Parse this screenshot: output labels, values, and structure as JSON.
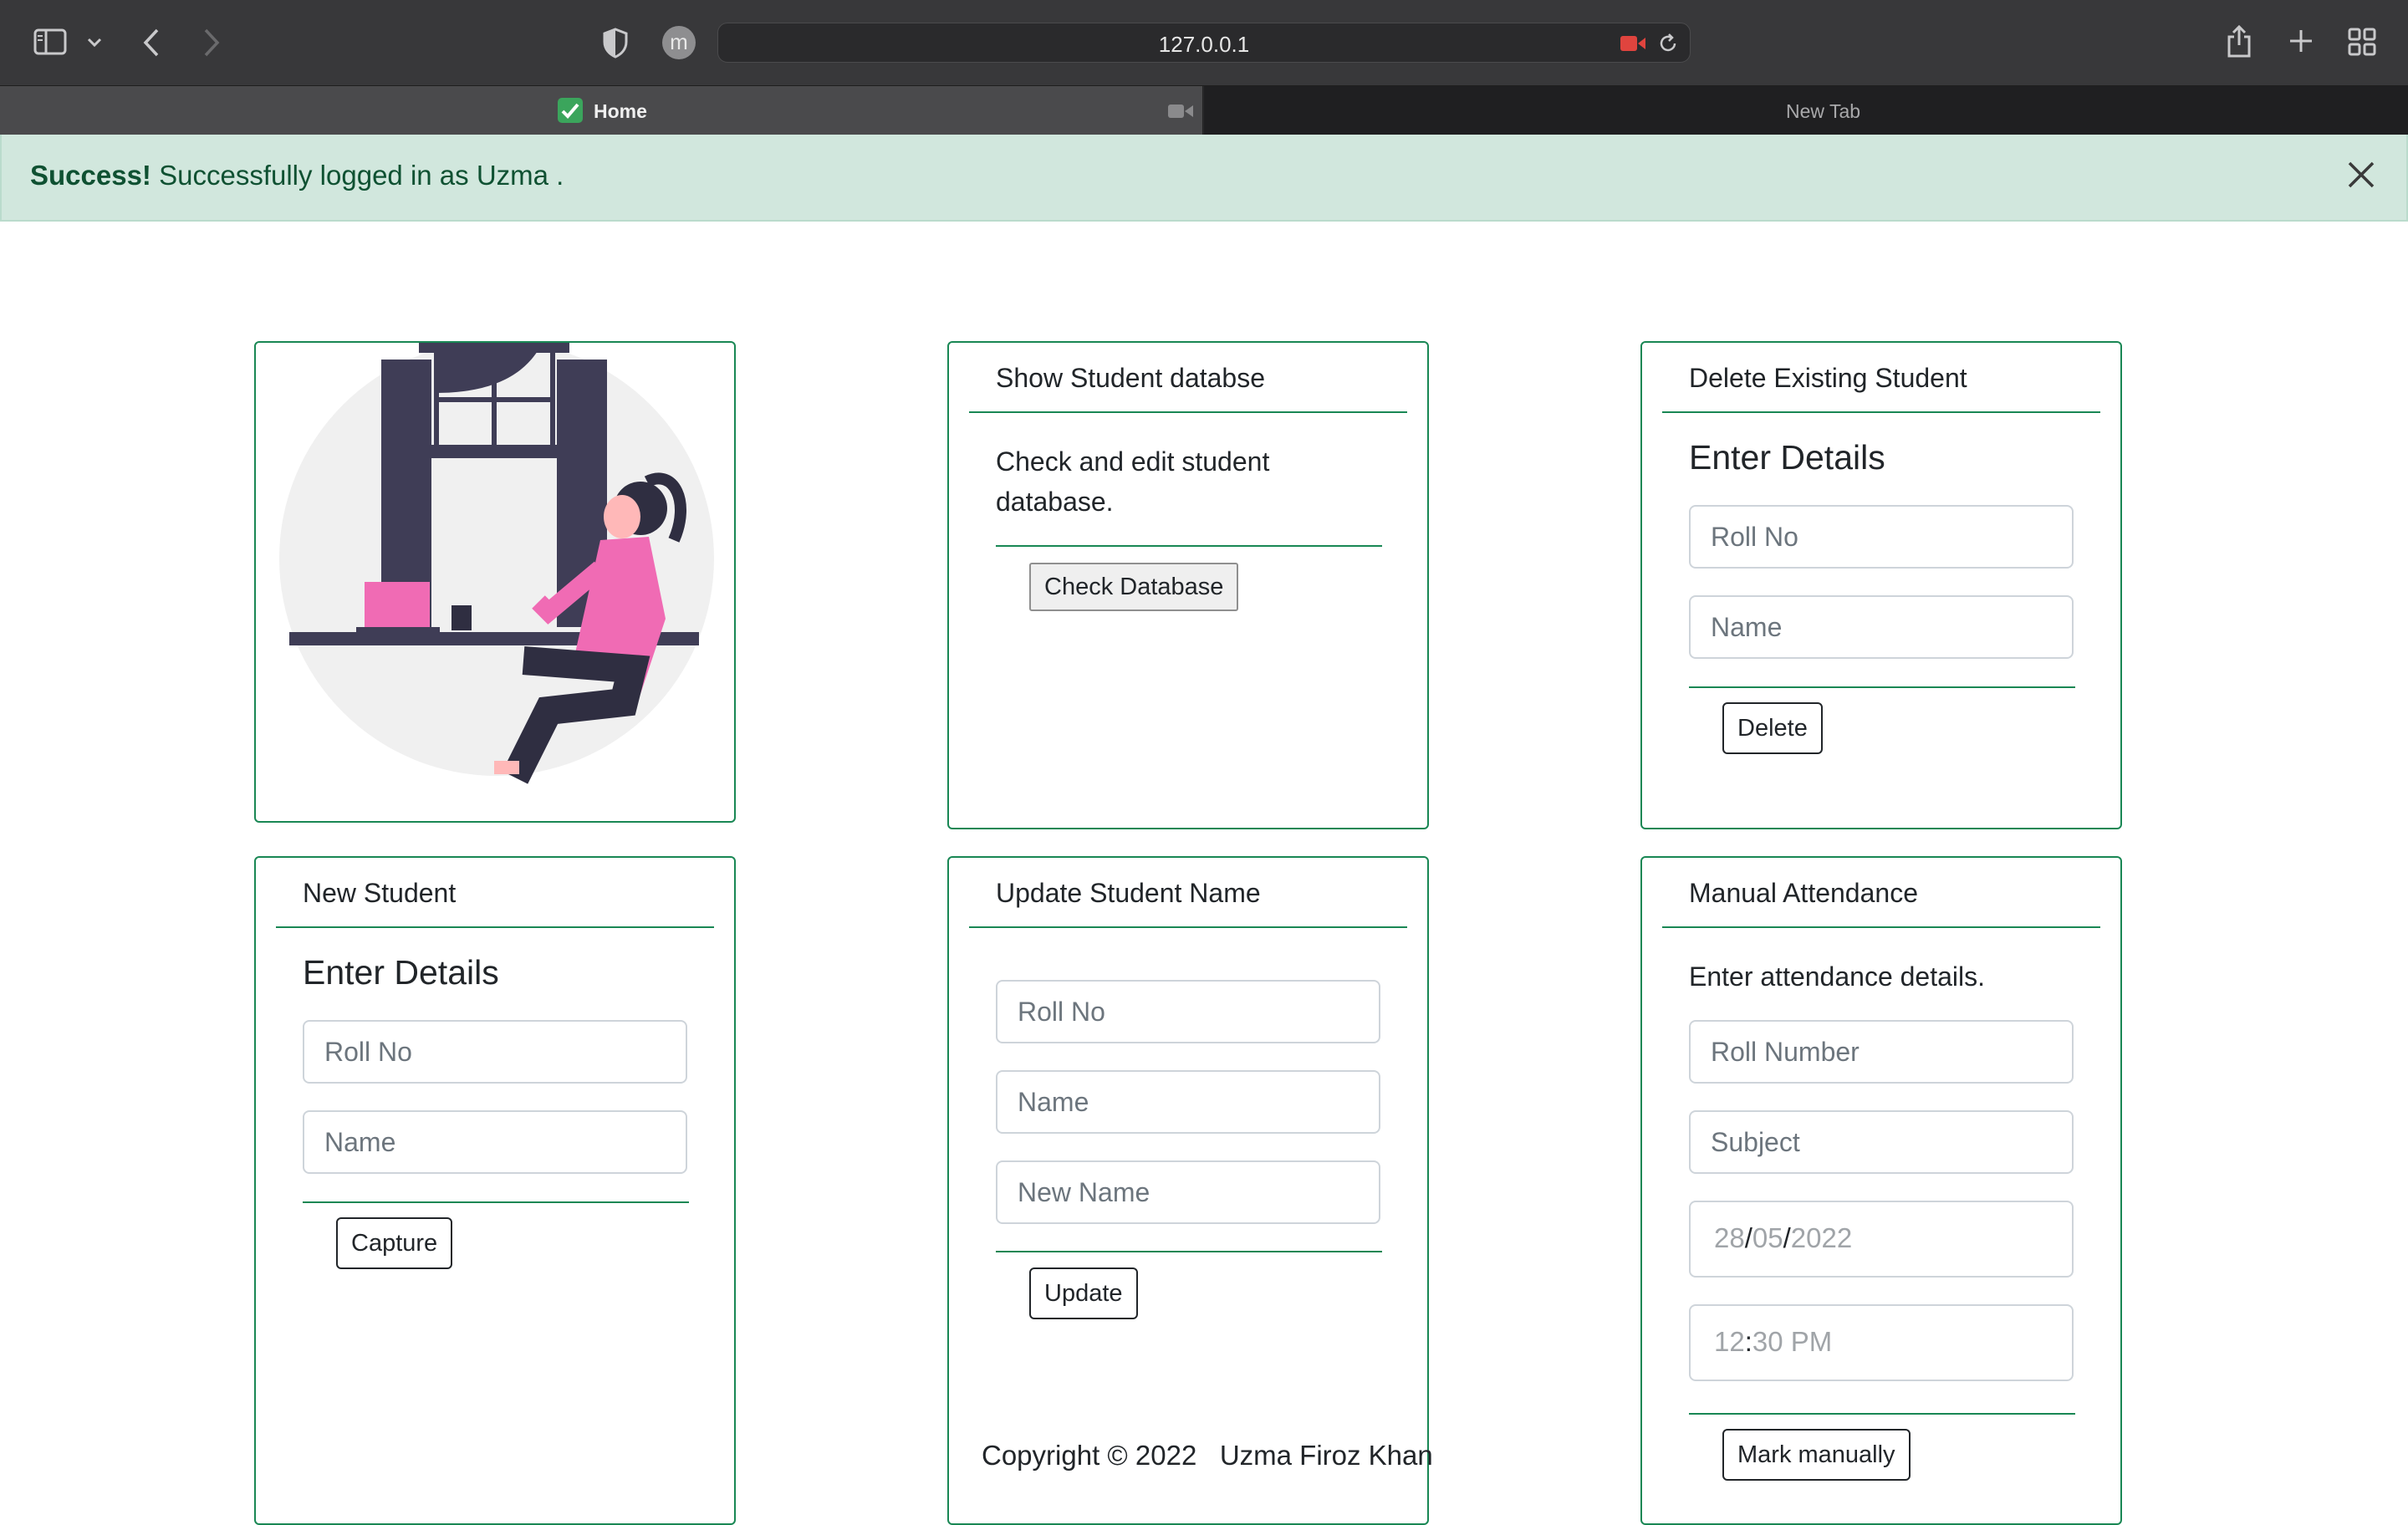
{
  "browser": {
    "url": "127.0.0.1",
    "tabs": [
      {
        "label": "Home",
        "active": true
      },
      {
        "label": "New Tab",
        "active": false
      }
    ],
    "profile_initial": "m"
  },
  "alert": {
    "strong": "Success!",
    "message": "Successfully logged in as Uzma .",
    "color": "#d1e7dd"
  },
  "cards": {
    "show_db": {
      "header": "Show Student databse",
      "text": "Check and edit student database.",
      "button": "Check Database"
    },
    "delete": {
      "header": "Delete Existing Student",
      "title": "Enter Details",
      "roll_placeholder": "Roll No",
      "name_placeholder": "Name",
      "button": "Delete"
    },
    "new_student": {
      "header": "New Student",
      "title": "Enter Details",
      "roll_placeholder": "Roll No",
      "name_placeholder": "Name",
      "button": "Capture"
    },
    "update": {
      "header": "Update Student Name",
      "roll_placeholder": "Roll No",
      "name_placeholder": "Name",
      "new_name_placeholder": "New Name",
      "button": "Update"
    },
    "attendance": {
      "header": "Manual Attendance",
      "text": "Enter attendance details.",
      "roll_placeholder": "Roll Number",
      "subject_placeholder": "Subject",
      "date": {
        "day": "28",
        "month": "05",
        "year": "2022"
      },
      "time": {
        "hour": "12",
        "minute": "30",
        "period": "PM"
      },
      "button": "Mark manually"
    }
  },
  "footer": {
    "copyright": "Copyright © 2022",
    "author": "Uzma Firoz Khan"
  },
  "colors": {
    "accent": "#198754",
    "chrome": "#38383a"
  }
}
